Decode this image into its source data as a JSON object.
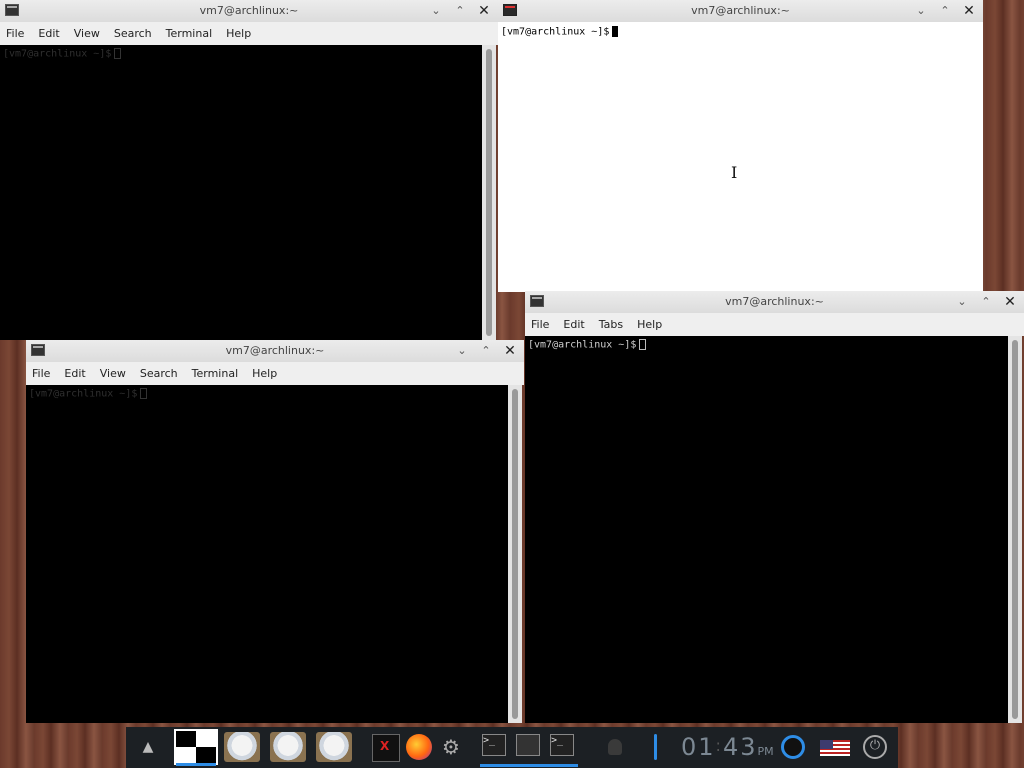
{
  "windows": {
    "topleft": {
      "title": "vm7@archlinux:~",
      "menu": [
        "File",
        "Edit",
        "View",
        "Search",
        "Terminal",
        "Help"
      ],
      "prompt": "[vm7@archlinux ~]$"
    },
    "xterm": {
      "title": "vm7@archlinux:~",
      "prompt": "[vm7@archlinux ~]$"
    },
    "bottomleft": {
      "title": "vm7@archlinux:~",
      "menu": [
        "File",
        "Edit",
        "View",
        "Search",
        "Terminal",
        "Help"
      ],
      "prompt": "[vm7@archlinux ~]$"
    },
    "lxterm": {
      "title": "vm7@archlinux:~",
      "menu": [
        "File",
        "Edit",
        "Tabs",
        "Help"
      ],
      "prompt": "[vm7@archlinux ~]$"
    }
  },
  "controls": {
    "minimize": "⌄",
    "maximize": "⌃",
    "close": "✕"
  },
  "taskbar": {
    "clock_hours": "01",
    "clock_minutes": "43",
    "clock_ampm": "PM",
    "up_arrow": "▲",
    "accent_color": "#2e8de6",
    "icons": [
      "xterm-icon",
      "firefox-icon",
      "gear-icon",
      "terminal-icon",
      "monitor-icon",
      "terminal-icon",
      "microphone-icon",
      "volume-icon",
      "network-icon",
      "us-flag-icon",
      "power-icon"
    ]
  }
}
